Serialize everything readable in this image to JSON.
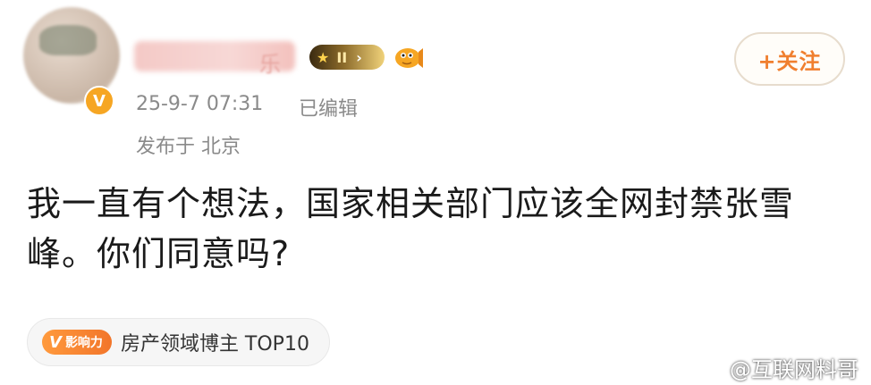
{
  "post": {
    "username_tail": "乐",
    "level_badge": {
      "star": "★",
      "level": "II",
      "arrow": "›"
    },
    "verify_badge": "V",
    "follow_label": "+关注",
    "time": "25-9-7 07:31",
    "edited": "已编辑",
    "location": "发布于 北京",
    "content": "我一直有个想法，国家相关部门应该全网封禁张雪峰。你们同意吗?",
    "influence": {
      "badge": "影响力",
      "badge_v": "V",
      "text": "房产领域博主 TOP10"
    }
  },
  "watermark": {
    "text": "@互联网料哥",
    "icon": "weibo-logo"
  },
  "colors": {
    "accent": "#f07f2f",
    "meta": "#8a8a8a",
    "badge": "#f6a623"
  }
}
